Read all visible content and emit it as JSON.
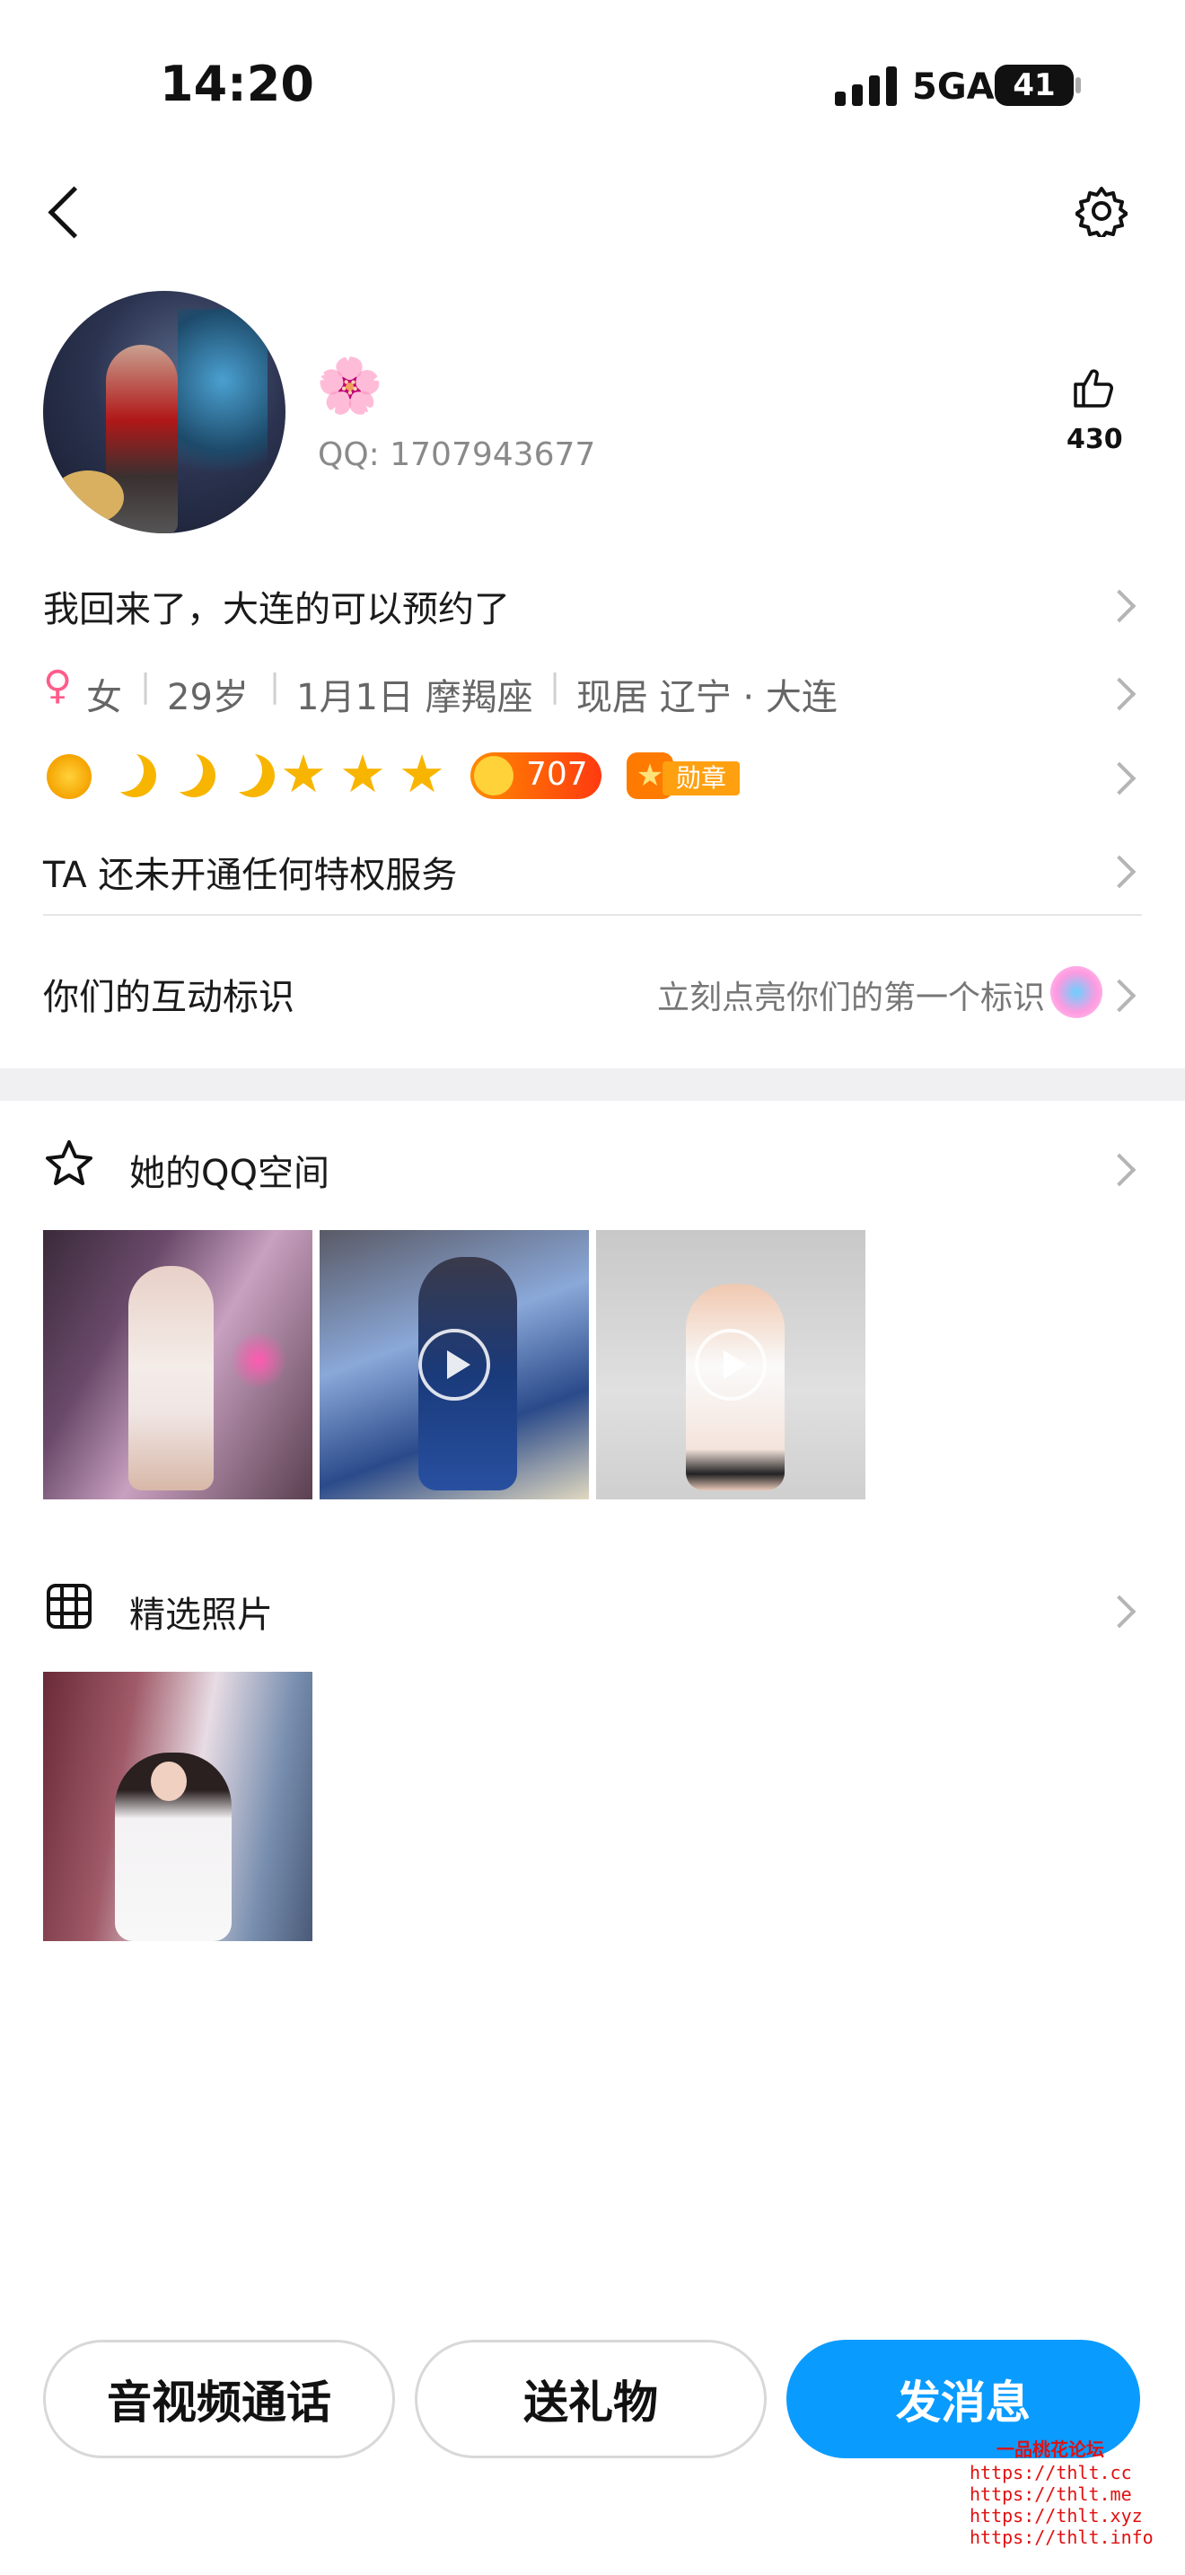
{
  "status_bar": {
    "time": "14:20",
    "network": "5GA",
    "battery": "41"
  },
  "profile": {
    "nickname_emoji": "🌸",
    "qq_label": "QQ: 1707943677",
    "likes": "430"
  },
  "bio": "我回来了，大连的可以预约了",
  "info": {
    "gender_symbol": "♀",
    "gender": "女",
    "age": "29岁",
    "birthday": "1月1日 摩羯座",
    "location": "现居 辽宁 · 大连"
  },
  "level": {
    "score": "707",
    "badge_label": "勋章"
  },
  "privilege_text": "TA 还未开通任何特权服务",
  "interaction": {
    "label": "你们的互动标识",
    "hint": "立刻点亮你们的第一个标识"
  },
  "qzone": {
    "title": "她的QQ空间"
  },
  "photos": {
    "title": "精选照片"
  },
  "actions": {
    "call": "音视频通话",
    "gift": "送礼物",
    "message": "发消息"
  },
  "watermark": {
    "title": "一品桃花论坛",
    "urls": [
      "https://thlt.cc",
      "https://thlt.me",
      "https://thlt.xyz",
      "https://thlt.info"
    ]
  },
  "colors": {
    "accent": "#0a9bff",
    "gender": "#ff5c8a",
    "gold": "#f7b500",
    "score_bg": "#ff5a1f",
    "section_gap": "#f0f0f2"
  }
}
